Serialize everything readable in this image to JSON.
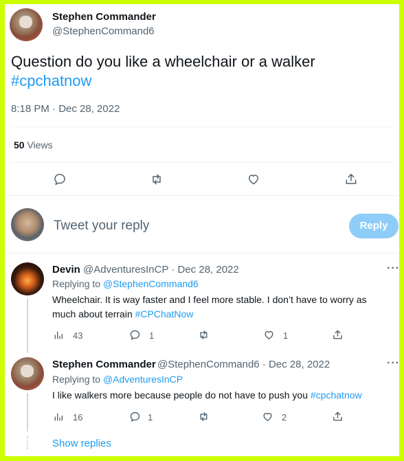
{
  "tweet": {
    "author_name": "Stephen Commander",
    "author_handle": "@StephenCommand6",
    "text": "Question  do you like a wheelchair or a walker",
    "hashtag": "#cpchatnow",
    "timestamp": "8:18 PM · Dec 28, 2022",
    "views_count": "50",
    "views_label": " Views"
  },
  "composer": {
    "placeholder": "Tweet your reply",
    "reply_button": "Reply"
  },
  "replies": [
    {
      "author_name": "Devin",
      "meta": "@AdventuresInCP · Dec 28, 2022",
      "replying_to_label": "Replying to ",
      "replying_to": "@StephenCommand6",
      "text_line1": "Wheelchair. It is way faster and I feel more stable. I don’t have to worry as",
      "text_line2": "much about terrain ",
      "hashtag": "#CPChatNow",
      "views": "43",
      "replies": "1",
      "likes": "1"
    },
    {
      "author_name": "Stephen Commander",
      "meta": "@StephenCommand6 · Dec 28, 2022",
      "replying_to_label": "Replying to ",
      "replying_to": "@AdventuresInCP",
      "text": "I like walkers  more because  people do not have to push  you ",
      "hashtag": "#cpchatnow",
      "views": "16",
      "replies": "1",
      "likes": "2"
    }
  ],
  "show_replies": "Show replies",
  "more_glyph": "···",
  "colors": {
    "accent": "#1d9bf0",
    "frame": "#ccff00",
    "muted": "#536471"
  },
  "icons": [
    "reply-icon",
    "retweet-icon",
    "like-icon",
    "share-icon",
    "analytics-icon",
    "more-icon"
  ]
}
